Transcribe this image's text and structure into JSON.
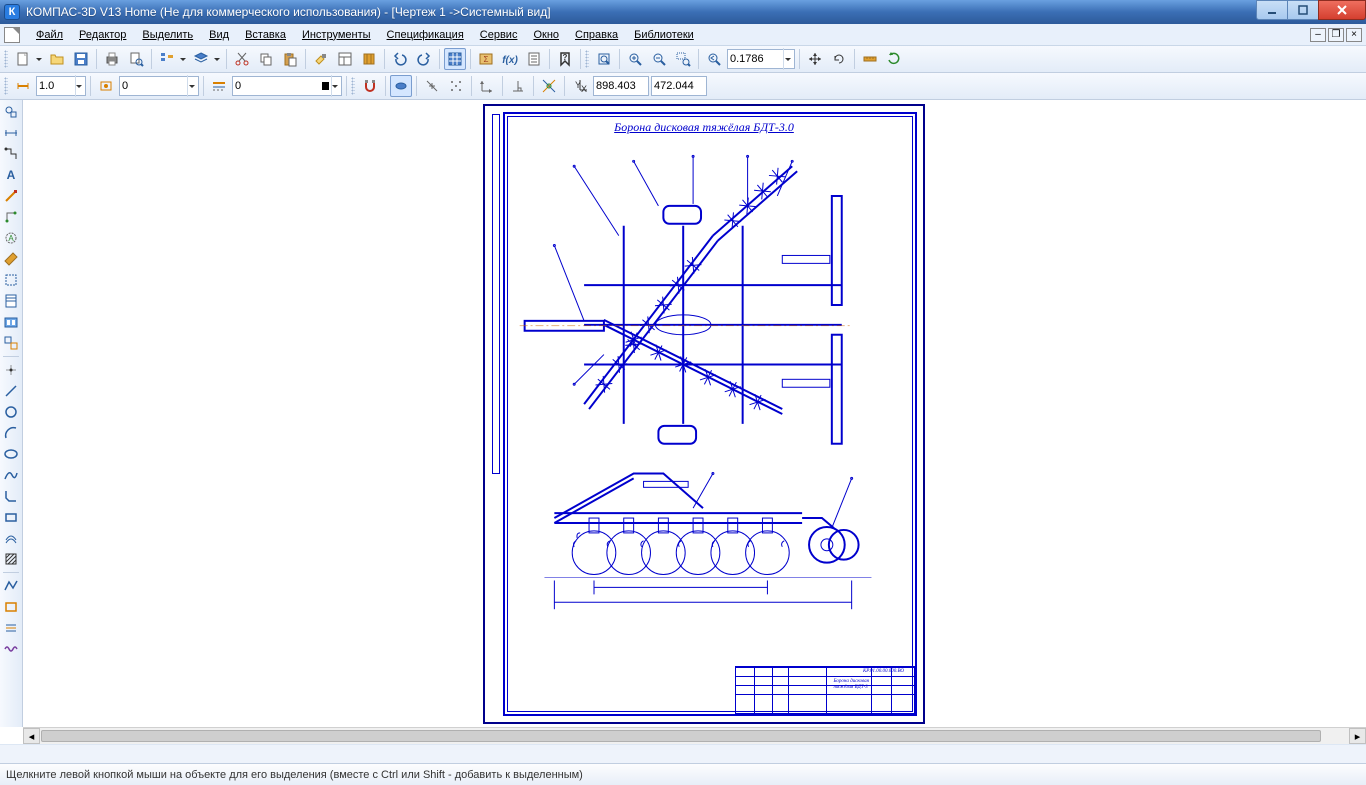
{
  "title": "КОМПАС-3D V13 Home (Не для коммерческого использования) - [Чертеж 1 ->Системный вид]",
  "menu": {
    "file": "Файл",
    "editor": "Редактор",
    "select": "Выделить",
    "view": "Вид",
    "insert": "Вставка",
    "tools": "Инструменты",
    "spec": "Спецификация",
    "service": "Сервис",
    "window": "Окно",
    "help": "Справка",
    "libs": "Библиотеки"
  },
  "toolbar1": {
    "zoom_value": "0.1786"
  },
  "toolbar2": {
    "scale": "1.0",
    "style1": "0",
    "style2": "0",
    "coord_x": "898.403",
    "coord_y": "472.044"
  },
  "drawing": {
    "title": "Борона дисковая тяжёлая БДТ-3.0",
    "code": "КР.01.00.00.000.ВО",
    "tb_line1": "Борона дисковая",
    "tb_line2": "тяжёлая БДТ-3"
  },
  "status": "Щелкните левой кнопкой мыши на объекте для его выделения (вместе с Ctrl или Shift - добавить к выделенным)"
}
